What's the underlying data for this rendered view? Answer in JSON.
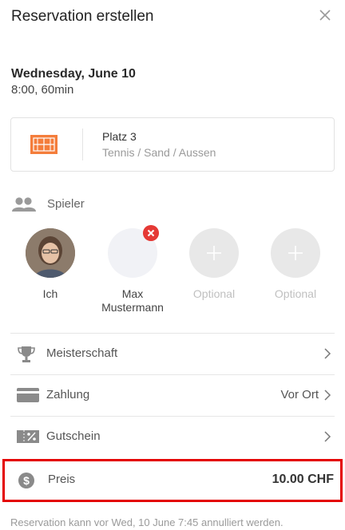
{
  "header": {
    "title": "Reservation erstellen",
    "close_icon": "close-icon"
  },
  "booking": {
    "date": "Wednesday, June 10",
    "time": "8:00, 60min"
  },
  "court": {
    "name": "Platz 3",
    "description": "Tennis / Sand / Aussen",
    "icon": "court-icon",
    "icon_color": "#f47d3b"
  },
  "players": {
    "label": "Spieler",
    "icon": "people-icon",
    "items": [
      {
        "name": "Ich",
        "type": "photo"
      },
      {
        "name": "Max Mustermann",
        "type": "empty",
        "removable": true
      },
      {
        "name": "Optional",
        "type": "add"
      },
      {
        "name": "Optional",
        "type": "add"
      }
    ]
  },
  "rows": [
    {
      "label": "Meisterschaft",
      "icon": "trophy-icon",
      "value": ""
    },
    {
      "label": "Zahlung",
      "icon": "card-icon",
      "value": "Vor Ort"
    },
    {
      "label": "Gutschein",
      "icon": "voucher-icon",
      "value": ""
    }
  ],
  "price": {
    "label": "Preis",
    "value": "10.00 CHF",
    "icon": "dollar-icon",
    "highlight_color": "#e40000"
  },
  "footer": {
    "note": "Reservation kann vor Wed, 10 June 7:45 annulliert werden."
  },
  "colors": {
    "remove_badge": "#e53935",
    "icon_gray": "#8a8a8a"
  }
}
